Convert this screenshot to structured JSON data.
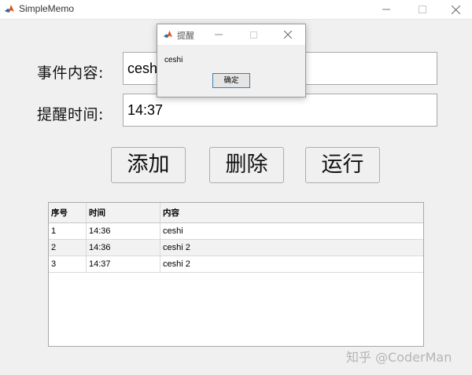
{
  "window": {
    "title": "SimpleMemo",
    "icon": "matlab-icon"
  },
  "form": {
    "event_label": "事件内容:",
    "event_value": "ceshi",
    "time_label": "提醒时间:",
    "time_value": "14:37"
  },
  "buttons": {
    "add": "添加",
    "delete": "删除",
    "run": "运行"
  },
  "table": {
    "headers": [
      "序号",
      "时间",
      "内容"
    ],
    "rows": [
      [
        "1",
        "14:36",
        "ceshi"
      ],
      [
        "2",
        "14:36",
        "ceshi 2"
      ],
      [
        "3",
        "14:37",
        "ceshi 2"
      ]
    ]
  },
  "dialog": {
    "title": "提醒",
    "message": "ceshi",
    "ok_label": "确定"
  },
  "watermark": "知乎 @CoderMan"
}
